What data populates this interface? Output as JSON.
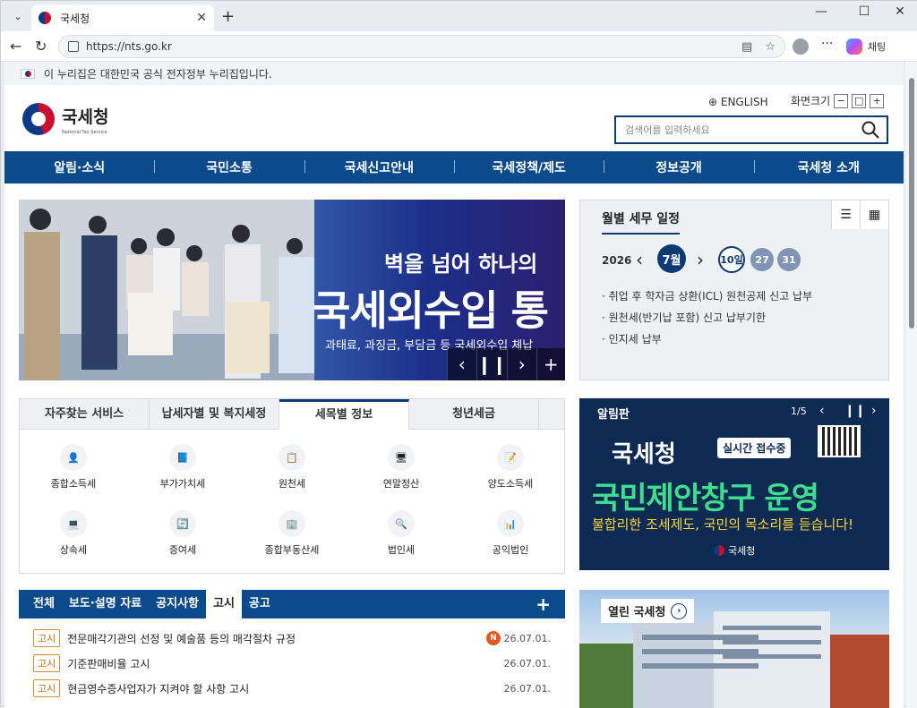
{
  "browser": {
    "tab_title": "국세청",
    "url": "https://nts.go.kr",
    "copilot_label": "채팅"
  },
  "gov_banner": "이 누리집은 대한민국 공식 전자정부 누리집입니다.",
  "header": {
    "logo_name": "국세청",
    "logo_sub": "National Tax Service",
    "english": "ENGLISH",
    "zoom_label": "화면크기",
    "search_placeholder": "검색어를 입력하세요"
  },
  "gnb": [
    "알림·소식",
    "국민소통",
    "국세신고안내",
    "국세정책/제도",
    "정보공개",
    "국세청 소개"
  ],
  "banner": {
    "line1": "벽을 넘어 하나의",
    "line2": "국세외수입 통",
    "line3": "과태료, 과징금, 부담금 등 국세외수입 체납"
  },
  "schedule": {
    "title": "월별 세무 일정",
    "year": "2026",
    "month": "7월",
    "days": [
      "10일",
      "27",
      "31"
    ],
    "events": [
      "· 취업 후 학자금 상환(ICL) 원천공제 신고 납부",
      "· 원천세(반기납 포함) 신고 납부기한",
      "· 인지세 납부"
    ]
  },
  "service_tabs": [
    "자주찾는 서비스",
    "납세자별 및 복지세정",
    "세목별 정보",
    "청년세금"
  ],
  "services": [
    "종합소득세",
    "부가가치세",
    "원천세",
    "연말정산",
    "양도소득세",
    "상속세",
    "증여세",
    "종합부동산세",
    "법인세",
    "공익법인"
  ],
  "notice": {
    "title": "알림판",
    "page": "1/5",
    "line1": "국세청",
    "chip": "실시간 접수중",
    "line2": "국민제안창구 운영",
    "line3": "불합리한 조세제도, 국민의 목소리를 듣습니다!",
    "seal": "국세청"
  },
  "board": {
    "tabs": [
      "전체",
      "보도·설명 자료",
      "공지사항",
      "고시",
      "공고"
    ],
    "rows": [
      {
        "tag": "고시",
        "title": "전문매각기관의 선정 및 예술품 등의 매각절차 규정",
        "date": "26.07.01.",
        "new": "N"
      },
      {
        "tag": "고시",
        "title": "기준판매비율 고시",
        "date": "26.07.01."
      },
      {
        "tag": "고시",
        "title": "현금영수증사업자가 지켜야 할 사항 고시",
        "date": "26.07.01."
      }
    ]
  },
  "open": {
    "title": "열린 국세청"
  }
}
